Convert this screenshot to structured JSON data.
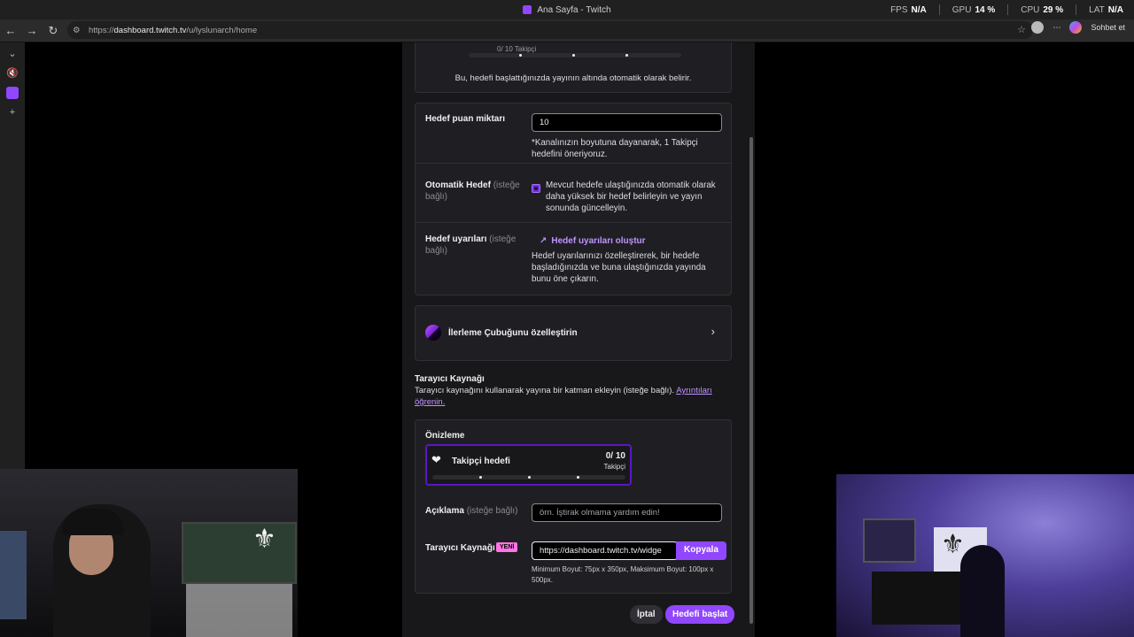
{
  "window": {
    "title": "Ana Sayfa - Twitch"
  },
  "perf": [
    {
      "label": "FPS",
      "value": "N/A"
    },
    {
      "label": "GPU",
      "value": "14 %"
    },
    {
      "label": "CPU",
      "value": "29 %"
    },
    {
      "label": "LAT",
      "value": "N/A"
    }
  ],
  "browser": {
    "url_prefix": "https://",
    "url_host": "dashboard.twitch.tv",
    "url_path": "/u/lyslunarch/home",
    "chat_label": "Sohbet et"
  },
  "top_preview": {
    "counter_text": "0/ 10 Takipçi",
    "note": "Bu, hedefi başlattığınızda yayının altında otomatik olarak belirir."
  },
  "settings": {
    "points_label": "Hedef puan miktarı",
    "points_value": "10",
    "points_hint": "*Kanalınızın boyutuna dayanarak, 1 Takipçi hedefini öneriyoruz.",
    "auto_label": "Otomatik Hedef",
    "auto_optional": "(isteğe bağlı)",
    "auto_desc": "Mevcut hedefe ulaştığınızda otomatik olarak daha yüksek bir hedef belirleyin ve yayın sonunda güncelleyin.",
    "alerts_label": "Hedef uyarıları",
    "alerts_optional": "(isteğe bağlı)",
    "alerts_link": "Hedef uyarıları oluştur",
    "alerts_desc": "Hedef uyarılarınızı özelleştirerek, bir hedefe başladığınızda ve buna ulaştığınızda yayında bunu öne çıkarın."
  },
  "customize": {
    "label": "İlerleme Çubuğunu özelleştirin"
  },
  "browser_source": {
    "heading": "Tarayıcı Kaynağı",
    "desc": "Tarayıcı kaynağını kullanarak yayına bir katman ekleyin (isteğe bağlı).",
    "learn_more": "Ayrıntıları öğrenin.",
    "preview_label": "Önizleme",
    "goal_title": "Takipçi hedefi",
    "goal_count": "0/ 10",
    "goal_unit": "Takipçi",
    "desc_label": "Açıklama",
    "desc_optional": "(isteğe bağlı)",
    "desc_placeholder": "örn. İştirak olmama yardım edin!",
    "source_label": "Tarayıcı Kaynağı",
    "new_badge": "YENİ",
    "source_url": "https://dashboard.twitch.tv/widge",
    "copy_label": "Kopyala",
    "size_hint": "Minimum Boyut: 75px x 350px, Maksimum Boyut: 100px x 500px."
  },
  "actions": {
    "cancel": "İptal",
    "start": "Hedefi başlat"
  },
  "colors": {
    "accent": "#9147ff",
    "panel": "#18181b",
    "card": "#1f1f23"
  }
}
